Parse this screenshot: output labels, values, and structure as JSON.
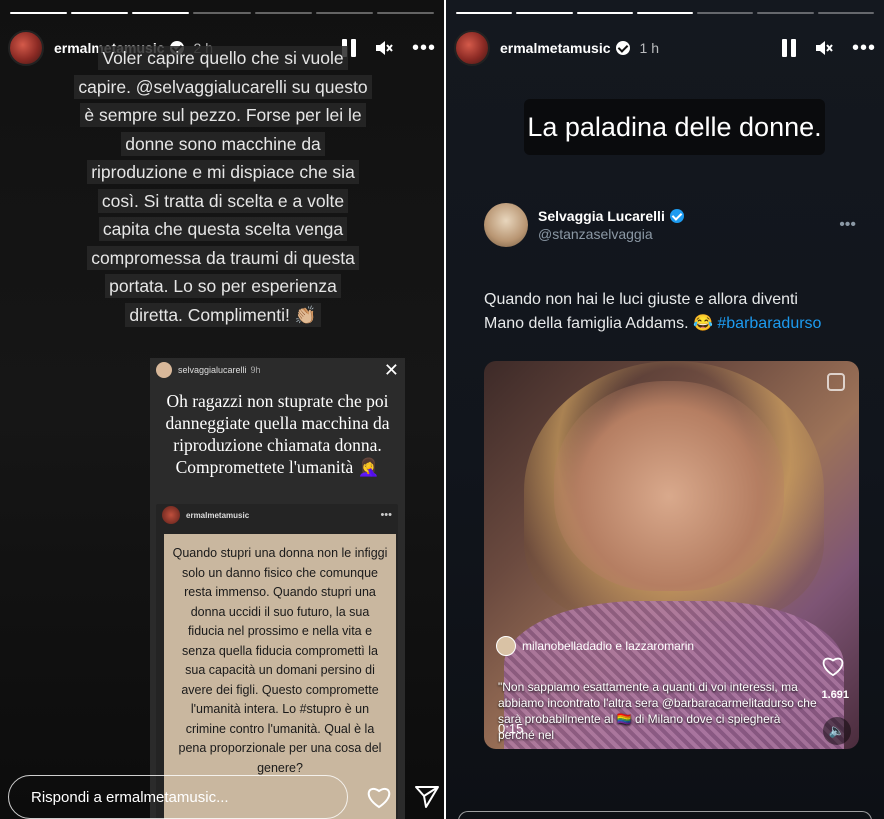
{
  "left_story": {
    "progress_total": 7,
    "progress_done": 3,
    "username": "ermalmetamusic",
    "time": "2 h",
    "caption_lines": [
      "Voler capire quello che si vuole",
      "capire. @selvaggialucarelli su questo",
      "è sempre sul pezzo. Forse per lei le",
      "donne sono macchine da",
      "riproduzione e mi dispiace che sia",
      "così. Si tratta di scelta e a volte",
      "capita che questa scelta venga",
      "compromessa da traumi di questa",
      "portata. Lo so per esperienza",
      "diretta. Complimenti! 👏🏼"
    ],
    "screenshot": {
      "username": "selvaggialucarelli",
      "time": "9h",
      "quote": "Oh ragazzi non stuprate che poi danneggiate quella macchina da riproduzione chiamata donna. Compromettete l'umanità 🤦‍♀️",
      "inner_username": "ermalmetamusic",
      "inner_text": "Quando stupri una donna non le infiggi solo un danno fisico che comunque resta immenso. Quando stupri una donna uccidi il suo futuro, la sua fiducia nel prossimo e nella vita e senza quella fiducia compromettì la sua capacità un domani persino di avere dei figli. Questo compromette l'umanità intera. Lo #stupro è un crimine contro l'umanità. Qual è la pena proporzionale per una cosa del genere?"
    },
    "reply_placeholder": "Rispondi a ermalmetamusic..."
  },
  "right_story": {
    "progress_total": 7,
    "progress_done": 4,
    "username": "ermalmetamusic",
    "time": "1 h",
    "title": "La paladina delle donne.",
    "tweet": {
      "name": "Selvaggia Lucarelli",
      "handle": "@stanzaselvaggia",
      "text_line1": "Quando non hai le luci giuste e allora diventi",
      "text_line2_start": "Mano della famiglia Addams. 😂 ",
      "hashtag": "#barbaradurso"
    },
    "video": {
      "creators": "milanobelladadio e lazzaromarin",
      "caption": "\"Non sappiamo esattamente a quanti di voi interessi, ma abbiamo incontrato l'altra sera @barbaracarmelitadurso che sarà probabilmente al 🏳️‍🌈 di Milano dove ci spiegherà perché nel",
      "timestamp": "0:15",
      "likes": "1.691"
    }
  }
}
